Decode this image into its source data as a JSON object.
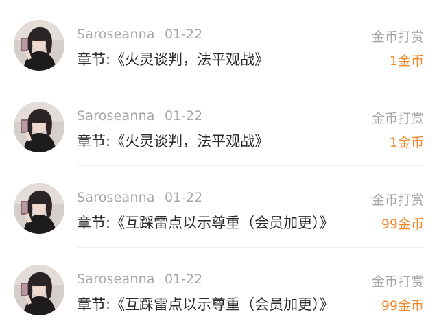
{
  "rewards": [
    {
      "username": "Saroseanna",
      "date": "01-22",
      "chapter": "章节:《火灵谈判，法平观战》",
      "label": "金币打赏",
      "amount": "1金币"
    },
    {
      "username": "Saroseanna",
      "date": "01-22",
      "chapter": "章节:《火灵谈判，法平观战》",
      "label": "金币打赏",
      "amount": "1金币"
    },
    {
      "username": "Saroseanna",
      "date": "01-22",
      "chapter": "章节:《互踩雷点以示尊重（会员加更）》",
      "label": "金币打赏",
      "amount": "99金币"
    },
    {
      "username": "Saroseanna",
      "date": "01-22",
      "chapter": "章节:《互踩雷点以示尊重（会员加更）》",
      "label": "金币打赏",
      "amount": "99金币"
    }
  ],
  "colors": {
    "muted": "#a7a7a7",
    "title": "#2a2a2a",
    "amount": "#f08a2e",
    "divider": "#f0f0f0"
  }
}
